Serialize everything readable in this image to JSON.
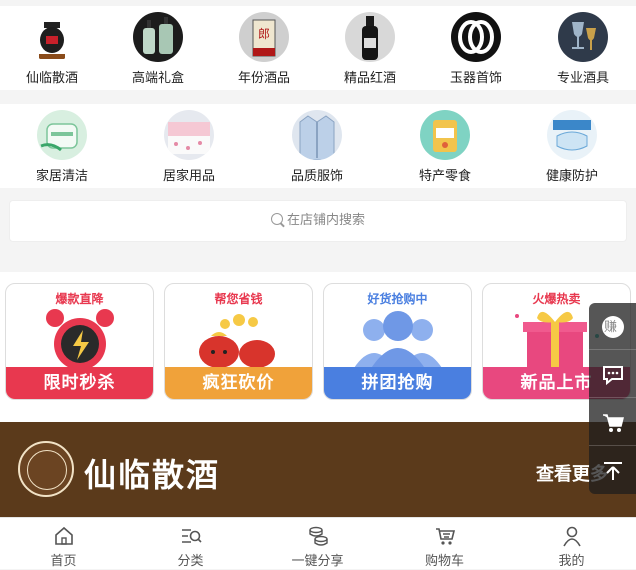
{
  "categories_row1": [
    {
      "label": "仙临散酒",
      "icon": "liquor-jar-icon"
    },
    {
      "label": "高端礼盒",
      "icon": "gift-bottles-icon"
    },
    {
      "label": "年份酒品",
      "icon": "vintage-liquor-icon"
    },
    {
      "label": "精品红酒",
      "icon": "red-wine-icon"
    },
    {
      "label": "玉器首饰",
      "icon": "jade-bangle-icon"
    },
    {
      "label": "专业酒具",
      "icon": "wine-glass-icon"
    }
  ],
  "categories_row2": [
    {
      "label": "家居清洁",
      "icon": "cleaning-icon"
    },
    {
      "label": "居家用品",
      "icon": "bedding-icon"
    },
    {
      "label": "品质服饰",
      "icon": "shirt-icon"
    },
    {
      "label": "特产零食",
      "icon": "snack-icon"
    },
    {
      "label": "健康防护",
      "icon": "mask-icon"
    }
  ],
  "search": {
    "placeholder": "在店铺内搜索"
  },
  "promos": [
    {
      "sub": "爆款直降",
      "title": "限时秒杀",
      "icon": "alarm-clock-icon",
      "color": "#e8384f"
    },
    {
      "sub": "帮您省钱",
      "title": "疯狂砍价",
      "icon": "money-bags-icon",
      "color": "#f0a23a"
    },
    {
      "sub": "好货抢购中",
      "title": "拼团抢购",
      "icon": "group-users-icon",
      "color": "#4a7fe0"
    },
    {
      "sub": "火爆热卖",
      "title": "新品上市",
      "icon": "gift-box-icon",
      "color": "#e8487f"
    }
  ],
  "brand": {
    "title": "仙临散酒",
    "more": "查看更多"
  },
  "sidebar": [
    "earn-icon",
    "chat-icon",
    "cart-icon",
    "back-to-top-icon"
  ],
  "sidebar_earn": "赚",
  "tabs": [
    {
      "label": "首页",
      "icon": "home-icon"
    },
    {
      "label": "分类",
      "icon": "category-search-icon"
    },
    {
      "label": "一键分享",
      "icon": "coins-share-icon"
    },
    {
      "label": "购物车",
      "icon": "cart-icon"
    },
    {
      "label": "我的",
      "icon": "user-icon"
    }
  ]
}
